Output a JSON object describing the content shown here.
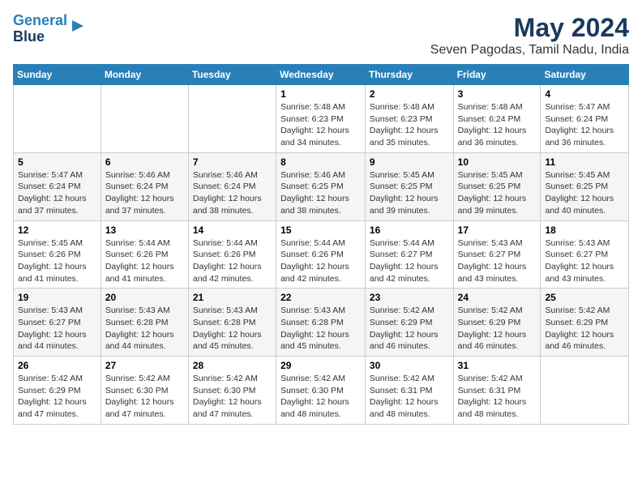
{
  "logo": {
    "line1": "General",
    "line2": "Blue"
  },
  "title": "May 2024",
  "subtitle": "Seven Pagodas, Tamil Nadu, India",
  "weekdays": [
    "Sunday",
    "Monday",
    "Tuesday",
    "Wednesday",
    "Thursday",
    "Friday",
    "Saturday"
  ],
  "weeks": [
    [
      {
        "day": "",
        "info": ""
      },
      {
        "day": "",
        "info": ""
      },
      {
        "day": "",
        "info": ""
      },
      {
        "day": "1",
        "info": "Sunrise: 5:48 AM\nSunset: 6:23 PM\nDaylight: 12 hours\nand 34 minutes."
      },
      {
        "day": "2",
        "info": "Sunrise: 5:48 AM\nSunset: 6:23 PM\nDaylight: 12 hours\nand 35 minutes."
      },
      {
        "day": "3",
        "info": "Sunrise: 5:48 AM\nSunset: 6:24 PM\nDaylight: 12 hours\nand 36 minutes."
      },
      {
        "day": "4",
        "info": "Sunrise: 5:47 AM\nSunset: 6:24 PM\nDaylight: 12 hours\nand 36 minutes."
      }
    ],
    [
      {
        "day": "5",
        "info": "Sunrise: 5:47 AM\nSunset: 6:24 PM\nDaylight: 12 hours\nand 37 minutes."
      },
      {
        "day": "6",
        "info": "Sunrise: 5:46 AM\nSunset: 6:24 PM\nDaylight: 12 hours\nand 37 minutes."
      },
      {
        "day": "7",
        "info": "Sunrise: 5:46 AM\nSunset: 6:24 PM\nDaylight: 12 hours\nand 38 minutes."
      },
      {
        "day": "8",
        "info": "Sunrise: 5:46 AM\nSunset: 6:25 PM\nDaylight: 12 hours\nand 38 minutes."
      },
      {
        "day": "9",
        "info": "Sunrise: 5:45 AM\nSunset: 6:25 PM\nDaylight: 12 hours\nand 39 minutes."
      },
      {
        "day": "10",
        "info": "Sunrise: 5:45 AM\nSunset: 6:25 PM\nDaylight: 12 hours\nand 39 minutes."
      },
      {
        "day": "11",
        "info": "Sunrise: 5:45 AM\nSunset: 6:25 PM\nDaylight: 12 hours\nand 40 minutes."
      }
    ],
    [
      {
        "day": "12",
        "info": "Sunrise: 5:45 AM\nSunset: 6:26 PM\nDaylight: 12 hours\nand 41 minutes."
      },
      {
        "day": "13",
        "info": "Sunrise: 5:44 AM\nSunset: 6:26 PM\nDaylight: 12 hours\nand 41 minutes."
      },
      {
        "day": "14",
        "info": "Sunrise: 5:44 AM\nSunset: 6:26 PM\nDaylight: 12 hours\nand 42 minutes."
      },
      {
        "day": "15",
        "info": "Sunrise: 5:44 AM\nSunset: 6:26 PM\nDaylight: 12 hours\nand 42 minutes."
      },
      {
        "day": "16",
        "info": "Sunrise: 5:44 AM\nSunset: 6:27 PM\nDaylight: 12 hours\nand 42 minutes."
      },
      {
        "day": "17",
        "info": "Sunrise: 5:43 AM\nSunset: 6:27 PM\nDaylight: 12 hours\nand 43 minutes."
      },
      {
        "day": "18",
        "info": "Sunrise: 5:43 AM\nSunset: 6:27 PM\nDaylight: 12 hours\nand 43 minutes."
      }
    ],
    [
      {
        "day": "19",
        "info": "Sunrise: 5:43 AM\nSunset: 6:27 PM\nDaylight: 12 hours\nand 44 minutes."
      },
      {
        "day": "20",
        "info": "Sunrise: 5:43 AM\nSunset: 6:28 PM\nDaylight: 12 hours\nand 44 minutes."
      },
      {
        "day": "21",
        "info": "Sunrise: 5:43 AM\nSunset: 6:28 PM\nDaylight: 12 hours\nand 45 minutes."
      },
      {
        "day": "22",
        "info": "Sunrise: 5:43 AM\nSunset: 6:28 PM\nDaylight: 12 hours\nand 45 minutes."
      },
      {
        "day": "23",
        "info": "Sunrise: 5:42 AM\nSunset: 6:29 PM\nDaylight: 12 hours\nand 46 minutes."
      },
      {
        "day": "24",
        "info": "Sunrise: 5:42 AM\nSunset: 6:29 PM\nDaylight: 12 hours\nand 46 minutes."
      },
      {
        "day": "25",
        "info": "Sunrise: 5:42 AM\nSunset: 6:29 PM\nDaylight: 12 hours\nand 46 minutes."
      }
    ],
    [
      {
        "day": "26",
        "info": "Sunrise: 5:42 AM\nSunset: 6:29 PM\nDaylight: 12 hours\nand 47 minutes."
      },
      {
        "day": "27",
        "info": "Sunrise: 5:42 AM\nSunset: 6:30 PM\nDaylight: 12 hours\nand 47 minutes."
      },
      {
        "day": "28",
        "info": "Sunrise: 5:42 AM\nSunset: 6:30 PM\nDaylight: 12 hours\nand 47 minutes."
      },
      {
        "day": "29",
        "info": "Sunrise: 5:42 AM\nSunset: 6:30 PM\nDaylight: 12 hours\nand 48 minutes."
      },
      {
        "day": "30",
        "info": "Sunrise: 5:42 AM\nSunset: 6:31 PM\nDaylight: 12 hours\nand 48 minutes."
      },
      {
        "day": "31",
        "info": "Sunrise: 5:42 AM\nSunset: 6:31 PM\nDaylight: 12 hours\nand 48 minutes."
      },
      {
        "day": "",
        "info": ""
      }
    ]
  ]
}
